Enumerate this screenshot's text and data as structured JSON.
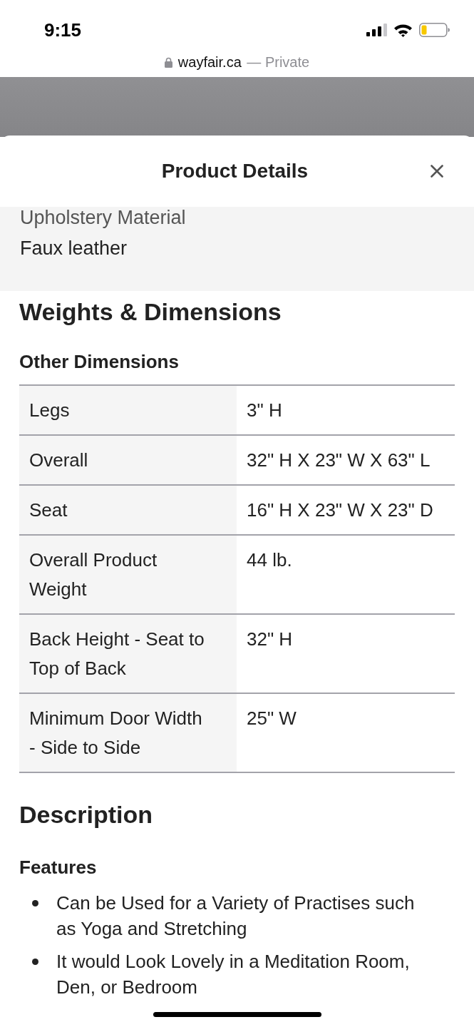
{
  "status_bar": {
    "time": "9:15"
  },
  "address_bar": {
    "domain": "wayfair.ca",
    "mode": "— Private"
  },
  "sheet": {
    "title": "Product Details"
  },
  "spec": {
    "label": "Upholstery Material",
    "value": "Faux leather"
  },
  "weights_dimensions": {
    "heading": "Weights & Dimensions",
    "subheading": "Other Dimensions",
    "rows": [
      {
        "label": "Legs",
        "value": "3\" H"
      },
      {
        "label": "Overall",
        "value": "32\" H X 23\" W X 63\" L"
      },
      {
        "label": "Seat",
        "value": "16\" H X 23\" W X 23\" D"
      },
      {
        "label": "Overall Product Weight",
        "value": "44 lb."
      },
      {
        "label": "Back Height - Seat to Top of Back",
        "value": "32\" H"
      },
      {
        "label": "Minimum Door Width - Side to Side",
        "value": "25\" W"
      }
    ]
  },
  "description": {
    "heading": "Description",
    "subheading": "Features",
    "bullets": [
      "Can be Used for a Variety of Practises such as Yoga and Stretching",
      "It would Look Lovely in a Meditation Room, Den, or Bedroom"
    ]
  }
}
